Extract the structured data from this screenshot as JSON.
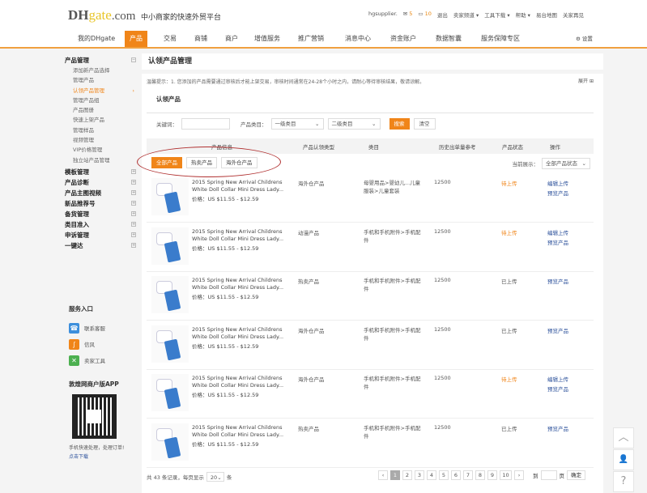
{
  "header": {
    "logo": "DHgate.com",
    "slogan": "中小商家的快速外贸平台",
    "user": "hgsupplier.",
    "mail_count": "5",
    "msg_count": "10",
    "links": [
      "退出",
      "卖家频道 ▾",
      "工具下载 ▾",
      "帮助 ▾",
      "易台地图",
      "关家再见"
    ]
  },
  "nav": {
    "items": [
      "我的DHgate",
      "产品",
      "交易",
      "商铺",
      "商户",
      "增值服务",
      "推广营销",
      "消息中心",
      "资金账户",
      "数据智囊",
      "服务保障专区"
    ],
    "settings": "设置"
  },
  "sidebar": {
    "group": "产品管理",
    "items": [
      "添加新产品选择",
      "管理产品",
      "认领产品管理",
      "管理产品组",
      "产品图册",
      "快速上架产品",
      "管理样品",
      "视频管理",
      "VIP价格管理",
      "独立站产品管理"
    ],
    "groups": [
      "模板管理",
      "产品诊断",
      "产品主图视频",
      "新品推荐号",
      "备货管理",
      "类目准入",
      "申诉管理",
      "一键达"
    ]
  },
  "services": {
    "title": "服务入口",
    "items": [
      "联系客服",
      "信风",
      "卖家工具"
    ],
    "app_title": "敦煌网商户版APP",
    "app_desc": "手机快速处理，处理订单!",
    "app_link": "点击下载"
  },
  "page": {
    "title": "认领产品管理",
    "tip": "温馨提示：1. 您添加的产品需要通过审核后才能上架交易，审核时间通常在24-28个小时之内，请耐心等待审核结果，敬请谅解。",
    "expand": "展开",
    "section": "认领产品",
    "filter": {
      "keyword_label": "关键词：",
      "keyword_value": "",
      "category_label": "产品类目：",
      "cat1": "一级类目",
      "cat2": "二级类目",
      "search": "搜索",
      "clear": "清空"
    },
    "columns": [
      "产品信息",
      "产品认领类型",
      "类目",
      "历史出单量参考",
      "产品状态",
      "操作"
    ],
    "tabs": [
      "全部产品",
      "热卖产品",
      "海外仓产品"
    ],
    "status_filter_label": "当前展示：",
    "status_filter": "全部产品状态",
    "rows": [
      {
        "name": "2015 Spring New Arrival Childrens White Doll Collar Mini Dress Lady...",
        "price": "价格：US $11.55 - $12.59",
        "type": "海外仓产品",
        "category": "母婴用品>婴幼儿...儿童服装>儿童套装",
        "orders": "12500",
        "status": "待上传",
        "waiting": true,
        "ops": [
          "编辑上传",
          "预览产品"
        ]
      },
      {
        "name": "2015 Spring New Arrival Childrens White Doll Collar Mini Dress Lady...",
        "price": "价格：US $11.55 - $12.59",
        "type": "动漫产品",
        "category": "手机和手机附件>手机配件",
        "orders": "12500",
        "status": "待上传",
        "waiting": true,
        "ops": [
          "编辑上传",
          "预览产品"
        ]
      },
      {
        "name": "2015 Spring New Arrival Childrens White Doll Collar Mini Dress Lady...",
        "price": "价格：US $11.55 - $12.59",
        "type": "热卖产品",
        "category": "手机和手机附件>手机配件",
        "orders": "12500",
        "status": "已上传",
        "waiting": false,
        "ops": [
          "预览产品"
        ]
      },
      {
        "name": "2015 Spring New Arrival Childrens White Doll Collar Mini Dress Lady...",
        "price": "价格：US $11.55 - $12.59",
        "type": "海外仓产品",
        "category": "手机和手机附件>手机配件",
        "orders": "12500",
        "status": "已上传",
        "waiting": false,
        "ops": [
          "预览产品"
        ]
      },
      {
        "name": "2015 Spring New Arrival Childrens White Doll Collar Mini Dress Lady...",
        "price": "价格：US $11.55 - $12.59",
        "type": "海外仓产品",
        "category": "手机和手机附件>手机配件",
        "orders": "12500",
        "status": "待上传",
        "waiting": true,
        "ops": [
          "编辑上传",
          "预览产品"
        ]
      },
      {
        "name": "2015 Spring New Arrival Childrens White Doll Collar Mini Dress Lady...",
        "price": "价格：US $11.55 - $12.59",
        "type": "热卖产品",
        "category": "手机和手机附件>手机配件",
        "orders": "12500",
        "status": "已上传",
        "waiting": false,
        "ops": [
          "预览产品"
        ]
      }
    ],
    "pagination": {
      "total": "共 43 条记录，每页显示",
      "per_page": "20",
      "unit": "条",
      "pages": [
        "‹",
        "1",
        "2",
        "3",
        "4",
        "5",
        "6",
        "7",
        "8",
        "9",
        "10",
        "›"
      ],
      "current": "1",
      "goto_label": "到",
      "page_label": "页",
      "confirm": "确定"
    }
  },
  "floats": [
    "︿",
    "👤",
    "?"
  ]
}
